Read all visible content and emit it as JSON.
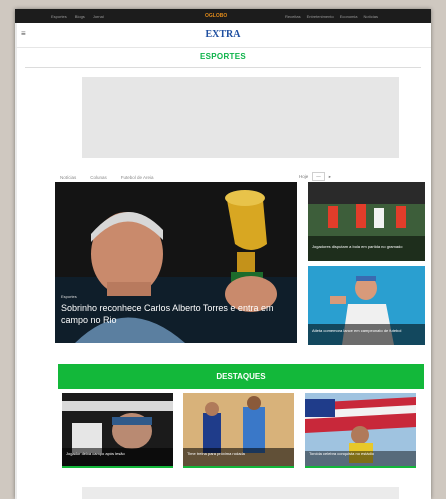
{
  "topbar": {
    "left_items": [
      "Esportes",
      "Blogs",
      "Jornal"
    ],
    "brand": "OGLOBO",
    "right_items": [
      "Receitas",
      "Entretenimento",
      "Economia",
      "Notícias"
    ]
  },
  "header": {
    "menu_icon": "hamburger-icon",
    "logo": "EXTRA"
  },
  "section_title": "ESPORTES",
  "subnav": {
    "items": [
      "Notícias",
      "Colunas",
      "Futebol de Areia"
    ],
    "right_label": "Hoje",
    "right_box": "—"
  },
  "main_story": {
    "category": "Esportes",
    "headline": "Sobrinho reconhece Carlos Alberto Torres e entra em campo no Rio"
  },
  "side_stories": [
    {
      "headline": "Jogadores disputam a bola em partida no gramado"
    },
    {
      "headline": "Atleta comemora lance em campeonato de futebol"
    }
  ],
  "highlights_title": "DESTAQUES",
  "cards": [
    {
      "headline": "Jogador deixa campo após lesão"
    },
    {
      "headline": "Time treina para próxima rodada"
    },
    {
      "headline": "Torcida celebra conquista no estádio"
    }
  ],
  "colors": {
    "accent_green": "#13b83a",
    "logo_blue": "#1f4fa0",
    "topbar_dark": "#1c1c1c"
  }
}
